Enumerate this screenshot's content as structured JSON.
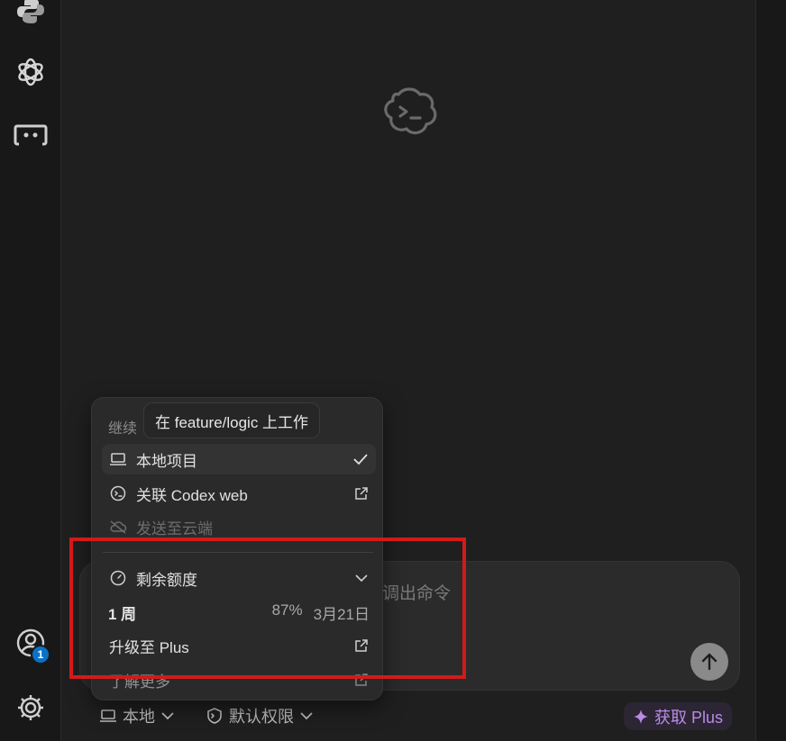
{
  "activity_bar": {
    "icons": [
      "python-icon",
      "openai-icon",
      "remote-explorer-icon",
      "accounts-icon",
      "settings-gear-icon"
    ],
    "accounts_badge": "1"
  },
  "composer": {
    "placeholder": "调出命令"
  },
  "bottom_bar": {
    "env_label": "本地",
    "permission_label": "默认权限",
    "get_plus_label": "获取 Plus"
  },
  "menu": {
    "header": "继续",
    "items": [
      {
        "label": "本地项目",
        "icon": "laptop-icon",
        "trail": "checkmark-icon",
        "selected": true
      },
      {
        "label": "关联 Codex web",
        "icon": "codex-icon",
        "trail": "external-link-icon"
      },
      {
        "label": "发送至云端",
        "icon": "cloud-off-icon",
        "disabled": true
      }
    ],
    "usage": {
      "title": "剩余额度",
      "period": "1 周",
      "percent": "87%",
      "reset_date": "3月21日"
    },
    "upgrade_label": "升级至 Plus",
    "learn_more_label": "了解更多"
  },
  "tooltip": {
    "text": "在 feature/logic 上工作"
  },
  "colors": {
    "accent_badge": "#0a72c7",
    "plus_purple": "#b98be6",
    "annotation_red": "#d21a1a"
  }
}
